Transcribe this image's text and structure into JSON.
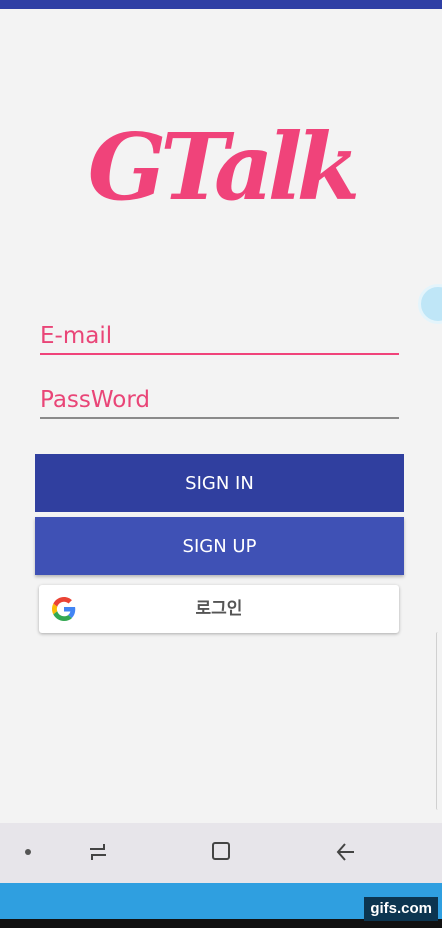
{
  "app": {
    "logo_text": "GTalk",
    "accent": "#f0437a"
  },
  "form": {
    "email_placeholder": "E-mail",
    "password_placeholder": "PassWord"
  },
  "buttons": {
    "sign_in": "SIGN IN",
    "sign_up": "SIGN UP",
    "google_login": "로그인"
  },
  "colors": {
    "sign_in_bg": "#303f9f",
    "sign_up_bg": "#3f51b5",
    "google_blue": "#4285F4",
    "google_red": "#EA4335",
    "google_yellow": "#FBBC05",
    "google_green": "#34A853"
  },
  "watermark": {
    "text": "gifs.com"
  },
  "icons": [
    "google-icon",
    "recent-apps-icon",
    "home-icon",
    "back-icon"
  ]
}
